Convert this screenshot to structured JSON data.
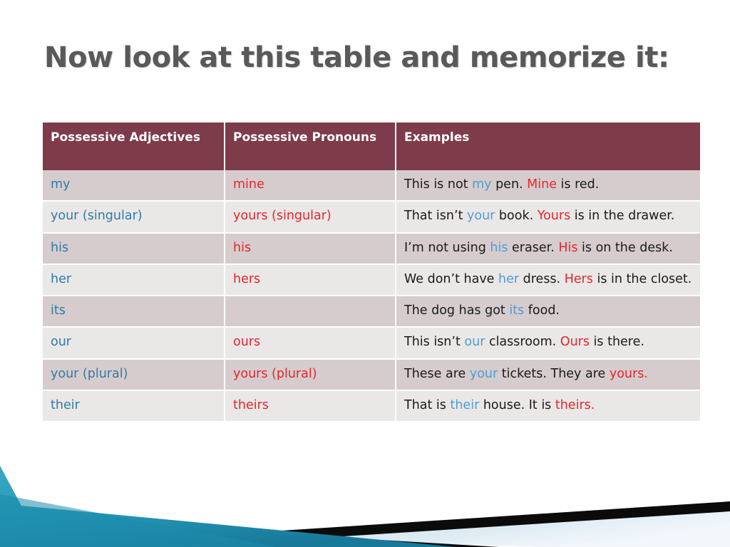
{
  "slide": {
    "title": "Now look at this table and memorize it:",
    "background_color": "#FFFFFF",
    "title_color": "#595959"
  },
  "decoration": {
    "teal_color": "#2A9AB8",
    "teal_dark_color": "#1B7A96",
    "black_color": "#000000",
    "pale_blue_color": "#D6E6EF"
  },
  "table": {
    "header_background": "#7E3B4A",
    "header_text_color": "#FFFFFF",
    "row_odd_background": "#D6CCCD",
    "row_even_background": "#EAE7E7",
    "adjective_color": "#2E7CA6",
    "pronoun_color": "#E2272C",
    "example_text_color": "#1A1A1A",
    "headers": [
      "Possessive Adjectives",
      "Possessive Pronouns",
      "Examples"
    ],
    "rows": [
      {
        "adjective": "my",
        "pronoun": "mine",
        "example_plain": "This is not my pen. Mine is red.",
        "example_parts": [
          {
            "text": "This is not ",
            "style": "plain"
          },
          {
            "text": "my",
            "style": "blue"
          },
          {
            "text": " pen. ",
            "style": "plain"
          },
          {
            "text": "Mine",
            "style": "red"
          },
          {
            "text": " is red.",
            "style": "plain"
          }
        ]
      },
      {
        "adjective": "your (singular)",
        "pronoun": "yours (singular)",
        "example_plain": "That isn’t your book. Yours is in the drawer.",
        "example_parts": [
          {
            "text": "That isn’t ",
            "style": "plain"
          },
          {
            "text": "your",
            "style": "blue"
          },
          {
            "text": " book. ",
            "style": "plain"
          },
          {
            "text": "Yours",
            "style": "red"
          },
          {
            "text": " is in the drawer.",
            "style": "plain"
          }
        ]
      },
      {
        "adjective": "his",
        "pronoun": "his",
        "example_plain": "I’m not using his eraser. His is on the desk.",
        "example_parts": [
          {
            "text": "I’m not using ",
            "style": "plain"
          },
          {
            "text": "his",
            "style": "blue"
          },
          {
            "text": " eraser. ",
            "style": "plain"
          },
          {
            "text": "His",
            "style": "red"
          },
          {
            "text": " is on the desk.",
            "style": "plain"
          }
        ]
      },
      {
        "adjective": "her",
        "pronoun": "hers",
        "example_plain": "We don’t have her dress. Hers is in the closet.",
        "example_parts": [
          {
            "text": "We don’t have ",
            "style": "plain"
          },
          {
            "text": "her",
            "style": "blue"
          },
          {
            "text": " dress. ",
            "style": "plain"
          },
          {
            "text": "Hers",
            "style": "red"
          },
          {
            "text": " is in the closet.",
            "style": "plain"
          }
        ]
      },
      {
        "adjective": "its",
        "pronoun": "",
        "example_plain": "The dog has got its food.",
        "example_parts": [
          {
            "text": "The dog has got ",
            "style": "plain"
          },
          {
            "text": "its",
            "style": "blue"
          },
          {
            "text": " food.",
            "style": "plain"
          }
        ]
      },
      {
        "adjective": "our",
        "pronoun": "ours",
        "example_plain": "This isn’t our classroom. Ours is there.",
        "example_parts": [
          {
            "text": "This isn’t ",
            "style": "plain"
          },
          {
            "text": "our",
            "style": "blue"
          },
          {
            "text": " classroom. ",
            "style": "plain"
          },
          {
            "text": "Ours",
            "style": "red"
          },
          {
            "text": " is there.",
            "style": "plain"
          }
        ]
      },
      {
        "adjective": "your (plural)",
        "pronoun": "yours (plural)",
        "example_plain": "These are your tickets. They are yours.",
        "example_parts": [
          {
            "text": "These are ",
            "style": "plain"
          },
          {
            "text": "your",
            "style": "blue"
          },
          {
            "text": " tickets. They are ",
            "style": "plain"
          },
          {
            "text": "yours.",
            "style": "red"
          }
        ]
      },
      {
        "adjective": "their",
        "pronoun": "theirs",
        "example_plain": "That is their house. It is theirs.",
        "example_parts": [
          {
            "text": "That is ",
            "style": "plain"
          },
          {
            "text": "their",
            "style": "blue"
          },
          {
            "text": " house. It is ",
            "style": "plain"
          },
          {
            "text": "theirs.",
            "style": "red"
          }
        ]
      }
    ]
  }
}
